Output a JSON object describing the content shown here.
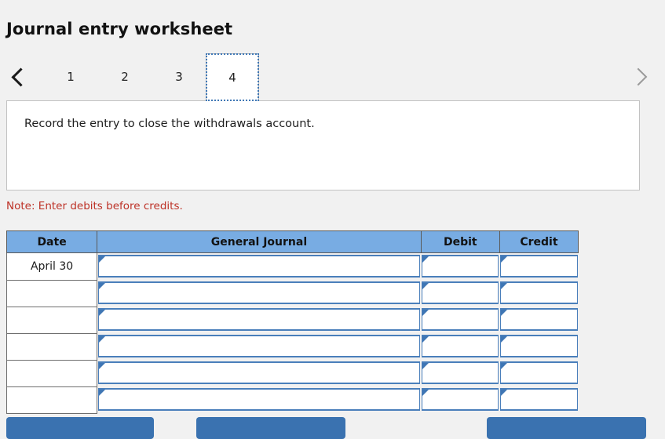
{
  "header": {
    "title": "Journal entry worksheet"
  },
  "pager": {
    "prev_icon": "chevron-left-icon",
    "next_icon": "chevron-right-icon",
    "tabs": [
      {
        "label": "1",
        "active": false
      },
      {
        "label": "2",
        "active": false
      },
      {
        "label": "3",
        "active": false
      },
      {
        "label": "4",
        "active": true
      }
    ]
  },
  "instruction": {
    "text": "Record the entry to close the withdrawals account."
  },
  "note": {
    "text": "Note: Enter debits before credits."
  },
  "table": {
    "columns": [
      "Date",
      "General Journal",
      "Debit",
      "Credit"
    ],
    "rows": [
      {
        "date": "April 30",
        "general_journal": "",
        "debit": "",
        "credit": ""
      },
      {
        "date": "",
        "general_journal": "",
        "debit": "",
        "credit": ""
      },
      {
        "date": "",
        "general_journal": "",
        "debit": "",
        "credit": ""
      },
      {
        "date": "",
        "general_journal": "",
        "debit": "",
        "credit": ""
      },
      {
        "date": "",
        "general_journal": "",
        "debit": "",
        "credit": ""
      },
      {
        "date": "",
        "general_journal": "",
        "debit": "",
        "credit": ""
      }
    ]
  },
  "buttons": {
    "record": "",
    "clear": "",
    "view_journal": ""
  },
  "colors": {
    "header_blue": "#78ace3",
    "field_blue": "#4a7fbb",
    "button_blue": "#3a72b0",
    "note_red": "#bd3126",
    "page_bg": "#f1f1f1",
    "focus_outline": "#3f77b5"
  }
}
